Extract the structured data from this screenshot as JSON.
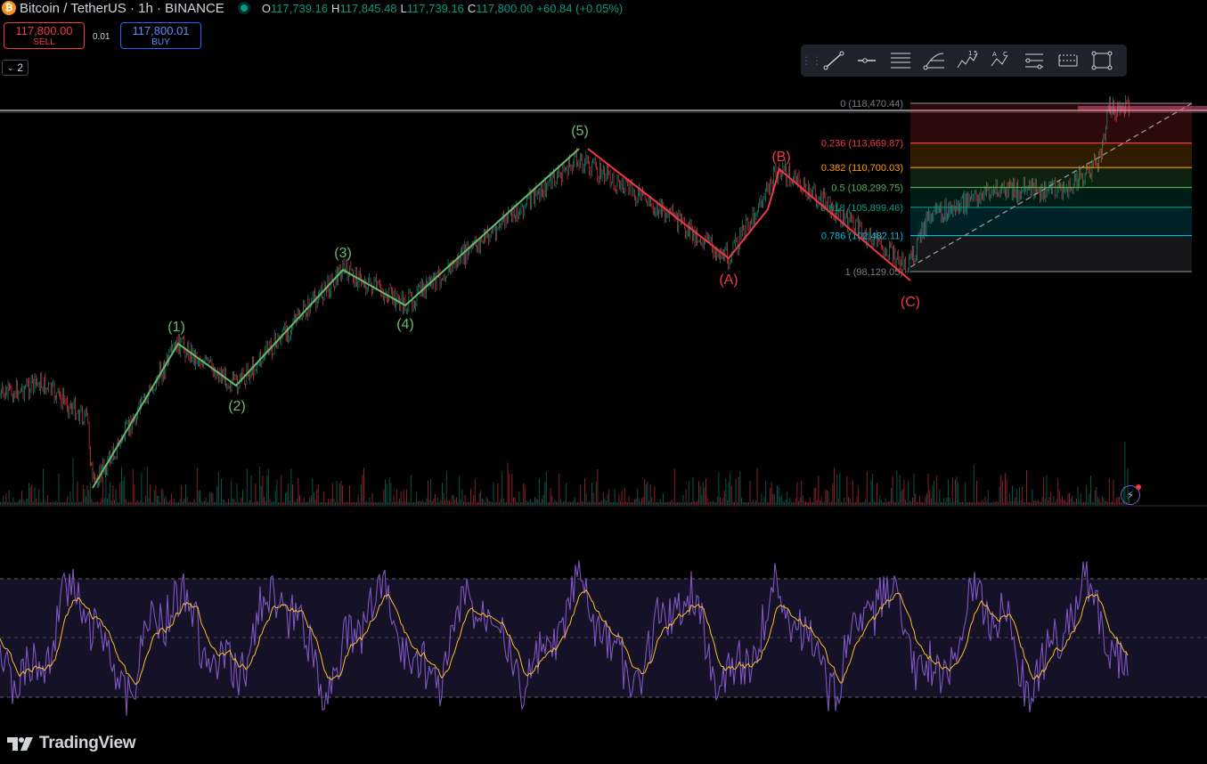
{
  "header": {
    "symbol": "Bitcoin / TetherUS · 1h · BINANCE",
    "ohlc": [
      {
        "k": "O",
        "v": "117,739.16"
      },
      {
        "k": "H",
        "v": "117,845.48"
      },
      {
        "k": "L",
        "v": "117,739.16"
      },
      {
        "k": "C",
        "v": "117,800.00"
      }
    ],
    "change": "+60.84 (+0.05%)"
  },
  "trade": {
    "sell_price": "117,800.00",
    "sell_label": "SELL",
    "buy_price": "117,800.01",
    "buy_label": "BUY",
    "spread": "0.01"
  },
  "collapse_count": "2",
  "toolbar": {
    "tools": [
      "grip-icon",
      "trend-line-icon",
      "horizontal-ray-icon",
      "parallel-channel-icon",
      "fib-retracement-icon",
      "elliott-impulse-icon",
      "elliott-correction-icon",
      "projection-icon",
      "date-price-range-icon",
      "rectangle-icon"
    ],
    "impulse_labels": [
      "1",
      "5"
    ],
    "correction_labels": [
      "A",
      "C"
    ]
  },
  "wave_labels": {
    "impulse": [
      "(1)",
      "(2)",
      "(3)",
      "(4)",
      "(5)"
    ],
    "correction": [
      "(A)",
      "(B)",
      "(C)"
    ]
  },
  "fib_levels": [
    {
      "label": "0 (118,470.44)",
      "ratio": 0,
      "color": "#787b86"
    },
    {
      "label": "0.236 (113,669.87)",
      "ratio": 0.236,
      "color": "#f23645"
    },
    {
      "label": "0.382 (110,700.03)",
      "ratio": 0.382,
      "color": "#ff9800"
    },
    {
      "label": "0.5 (108,299.75)",
      "ratio": 0.5,
      "color": "#4caf50"
    },
    {
      "label": "0.618 (105,899.46)",
      "ratio": 0.618,
      "color": "#089981"
    },
    {
      "label": "0.786 (102,482.11)",
      "ratio": 0.786,
      "color": "#00bcd4"
    },
    {
      "label": "1 (98,129.05)",
      "ratio": 1,
      "color": "#787b86"
    }
  ],
  "watermark": "TradingView",
  "colors": {
    "impulse": "#66bb6a",
    "correction": "#f23645",
    "bull": "#089981",
    "bear": "#f23645",
    "rsi": "#7e57c2",
    "rsi_ma": "#fbc02d"
  }
}
